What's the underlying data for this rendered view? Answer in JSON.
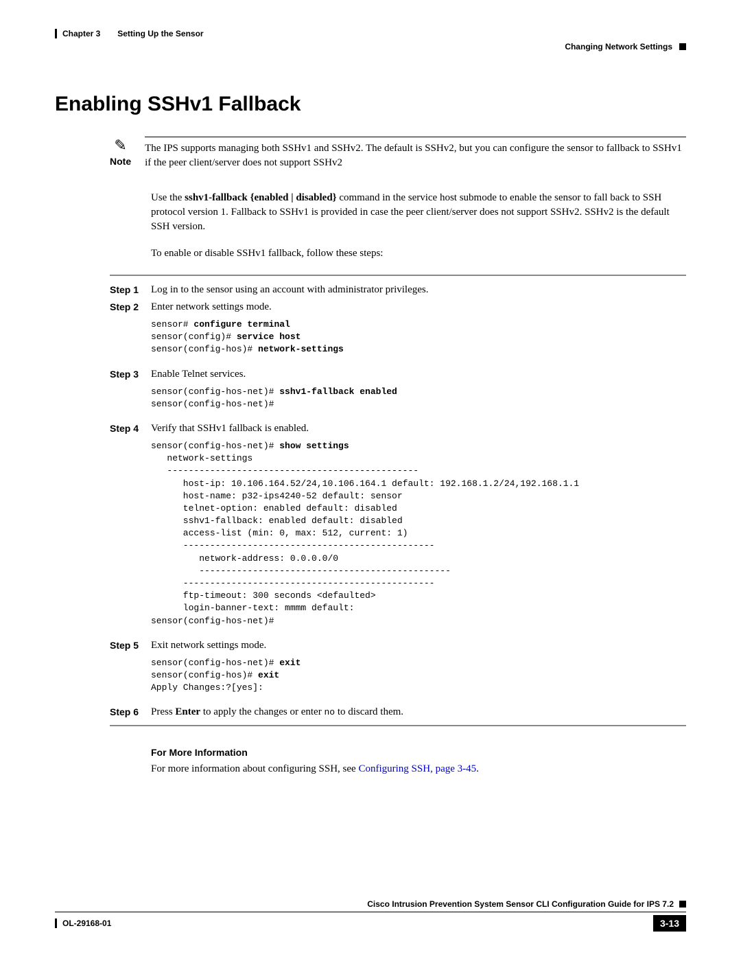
{
  "header": {
    "chapter": "Chapter 3",
    "chapter_title": "Setting Up the Sensor",
    "section_title": "Changing Network Settings"
  },
  "heading": "Enabling SSHv1 Fallback",
  "note": {
    "label": "Note",
    "text": "The IPS supports managing both SSHv1 and SSHv2. The default is SSHv2, but you can configure the sensor to fallback to SSHv1 if the peer client/server does not support SSHv2"
  },
  "intro_para1_pre": "Use the ",
  "intro_para1_bold": "sshv1-fallback {enabled | disabled}",
  "intro_para1_post": " command in the service host submode to enable the sensor to fall back to SSH protocol version 1. Fallback to SSHv1 is provided in case the peer client/server does not support SSHv2. SSHv2 is the default SSH version.",
  "intro_para2": "To enable or disable SSHv1 fallback, follow these steps:",
  "steps": {
    "s1": {
      "label": "Step 1",
      "text": "Log in to the sensor using an account with administrator privileges."
    },
    "s2": {
      "label": "Step 2",
      "text": "Enter network settings mode.",
      "code_l1a": "sensor# ",
      "code_l1b": "configure terminal",
      "code_l2a": "sensor(config)# ",
      "code_l2b": "service host",
      "code_l3a": "sensor(config-hos)# ",
      "code_l3b": "network-settings"
    },
    "s3": {
      "label": "Step 3",
      "text": "Enable Telnet services.",
      "code_l1a": "sensor(config-hos-net)# ",
      "code_l1b": "sshv1-fallback enabled",
      "code_l2": "sensor(config-hos-net)# "
    },
    "s4": {
      "label": "Step 4",
      "text": "Verify that SSHv1 fallback is enabled.",
      "code_l1a": "sensor(config-hos-net)# ",
      "code_l1b": "show settings",
      "code_rest": "   network-settings\n   -----------------------------------------------\n      host-ip: 10.106.164.52/24,10.106.164.1 default: 192.168.1.2/24,192.168.1.1\n      host-name: p32-ips4240-52 default: sensor\n      telnet-option: enabled default: disabled\n      sshv1-fallback: enabled default: disabled\n      access-list (min: 0, max: 512, current: 1)\n      -----------------------------------------------\n         network-address: 0.0.0.0/0\n         -----------------------------------------------\n      -----------------------------------------------\n      ftp-timeout: 300 seconds <defaulted>\n      login-banner-text: mmmm default:\nsensor(config-hos-net)#"
    },
    "s5": {
      "label": "Step 5",
      "text": "Exit network settings mode.",
      "code_l1a": "sensor(config-hos-net)# ",
      "code_l1b": "exit",
      "code_l2a": "sensor(config-hos)# ",
      "code_l2b": "exit",
      "code_l3": "Apply Changes:?[yes]:"
    },
    "s6": {
      "label": "Step 6",
      "t1": "Press ",
      "t2": "Enter",
      "t3": " to apply the changes or enter ",
      "t4": "no",
      "t5": " to discard them."
    }
  },
  "more_info": {
    "heading": "For More Information",
    "text_pre": "For more information about configuring SSH, see ",
    "link": "Configuring SSH, page 3-45",
    "text_post": "."
  },
  "footer": {
    "guide_title": "Cisco Intrusion Prevention System Sensor CLI Configuration Guide for IPS 7.2",
    "doc_id": "OL-29168-01",
    "page_number": "3-13"
  }
}
